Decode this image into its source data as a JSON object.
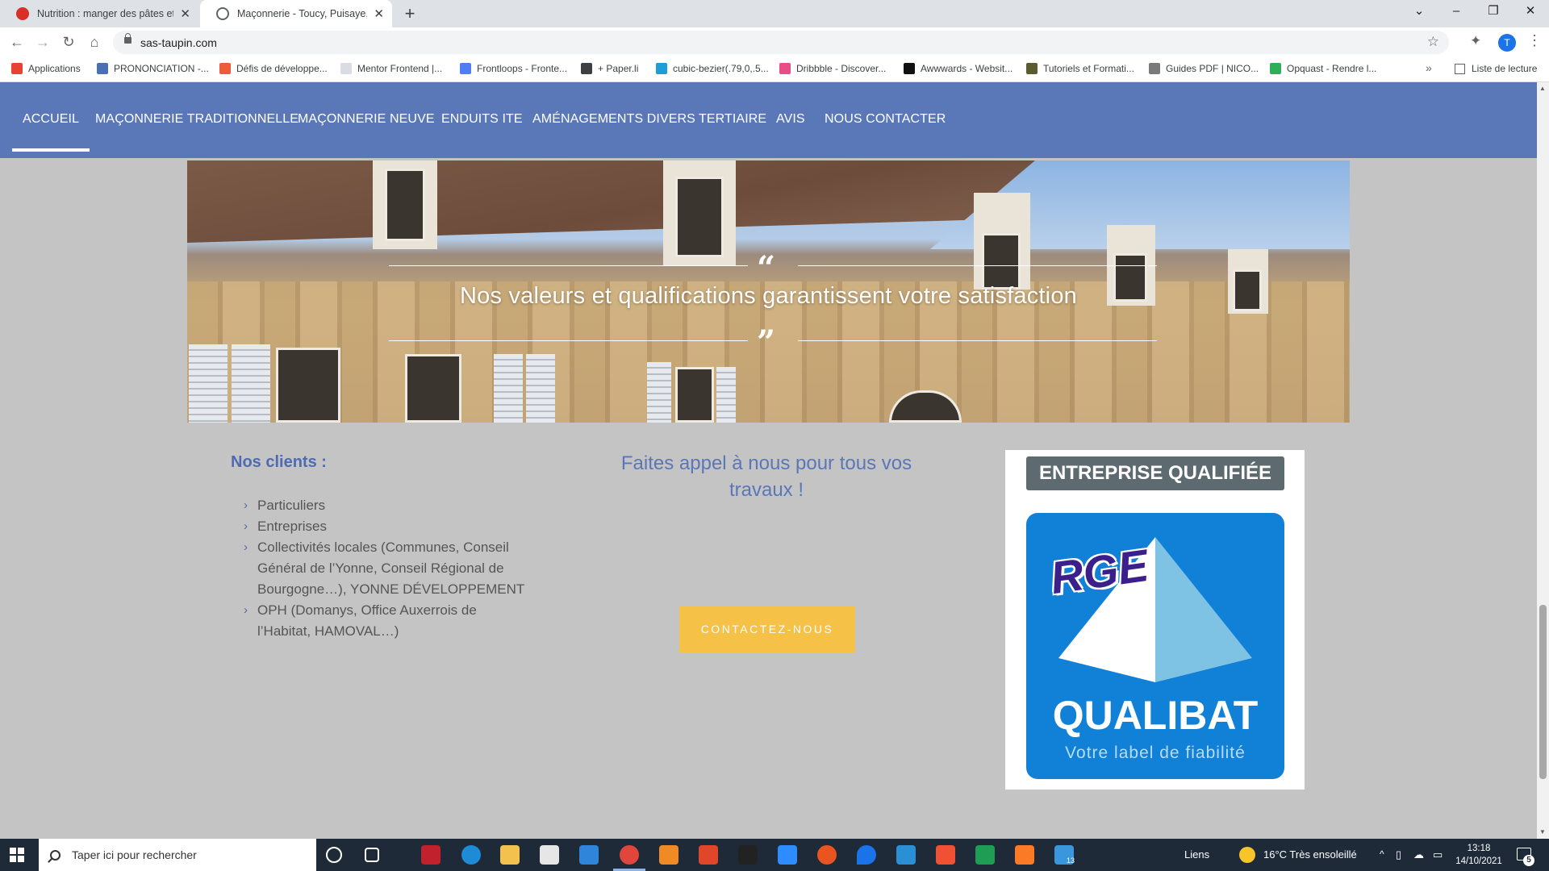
{
  "browser": {
    "tabs": [
      {
        "title": "Nutrition : manger des pâtes et d",
        "favicon_color": "#d93025",
        "active": false
      },
      {
        "title": "Maçonnerie - Toucy, Puisaye, Yon",
        "favicon_color": "#5f6368",
        "active": true
      }
    ],
    "url": "sas-taupin.com",
    "profile_initial": "T",
    "bookmarks": [
      {
        "label": "Applications",
        "icon_color": "#e94235"
      },
      {
        "label": "PRONONCIATION -...",
        "icon_color": "#4a6fb5"
      },
      {
        "label": "Défis de développe...",
        "icon_color": "#ef5a3c"
      },
      {
        "label": "Mentor Frontend |...",
        "icon_color": "#d9dde3"
      },
      {
        "label": "Frontloops - Fronte...",
        "icon_color": "#4f7df3"
      },
      {
        "label": "+ Paper.li",
        "icon_color": "#3c4043"
      },
      {
        "label": "cubic-bezier(.79,0,.5...",
        "icon_color": "#1e9ed8"
      },
      {
        "label": "Dribbble - Discover...",
        "icon_color": "#ea4c89"
      },
      {
        "label": "Awwwards - Websit...",
        "icon_color": "#111111"
      },
      {
        "label": "Tutoriels et Formati...",
        "icon_color": "#5b5b2d"
      },
      {
        "label": "Guides PDF | NICO...",
        "icon_color": "#7a7a7a"
      },
      {
        "label": "Opquast - Rendre l...",
        "icon_color": "#2fae5a"
      }
    ],
    "reading_list": "Liste de lecture",
    "more_bookmarks": "»"
  },
  "site": {
    "nav": [
      "ACCUEIL",
      "MAÇONNERIE TRADITIONNELLE",
      "MAÇONNERIE NEUVE",
      "ENDUITS ITE",
      "AMÉNAGEMENTS DIVERS",
      "TERTIAIRE",
      "AVIS",
      "NOUS CONTACTER"
    ],
    "hero": {
      "open_quote": "“",
      "close_quote": "”",
      "text": "Nos valeurs et qualifications garantissent votre satisfaction"
    },
    "clients": {
      "title": "Nos clients :",
      "items": [
        "Particuliers",
        "Entreprises",
        "Collectivités locales (Communes, Conseil Général de l’Yonne, Conseil Régional de Bourgogne…), YONNE DÉVELOPPEMENT",
        "OPH (Domanys, Office Auxerrois de l’Habitat, HAMOVAL…)"
      ]
    },
    "cta": {
      "title": "Faites appel à nous pour tous vos travaux !",
      "button": "CONTACTEZ-NOUS"
    },
    "badge": {
      "header": "ENTREPRISE QUALIFIÉE",
      "logo_word": "RGE",
      "brand": "QUALIBAT",
      "tagline": "Votre label de fiabilité"
    },
    "colors": {
      "nav_bg": "#5a77b8",
      "accent_blue": "#4f6ab1",
      "button_yellow": "#f5c147",
      "page_bg": "#c4c4c4",
      "qualibat_blue": "#1181d8"
    }
  },
  "taskbar": {
    "search_placeholder": "Taper ici pour rechercher",
    "links_label": "Liens",
    "weather": "16°C  Très ensoleillé",
    "time": "13:18",
    "date": "14/10/2021",
    "badge_count_vs": "13",
    "notification_count": "5"
  }
}
